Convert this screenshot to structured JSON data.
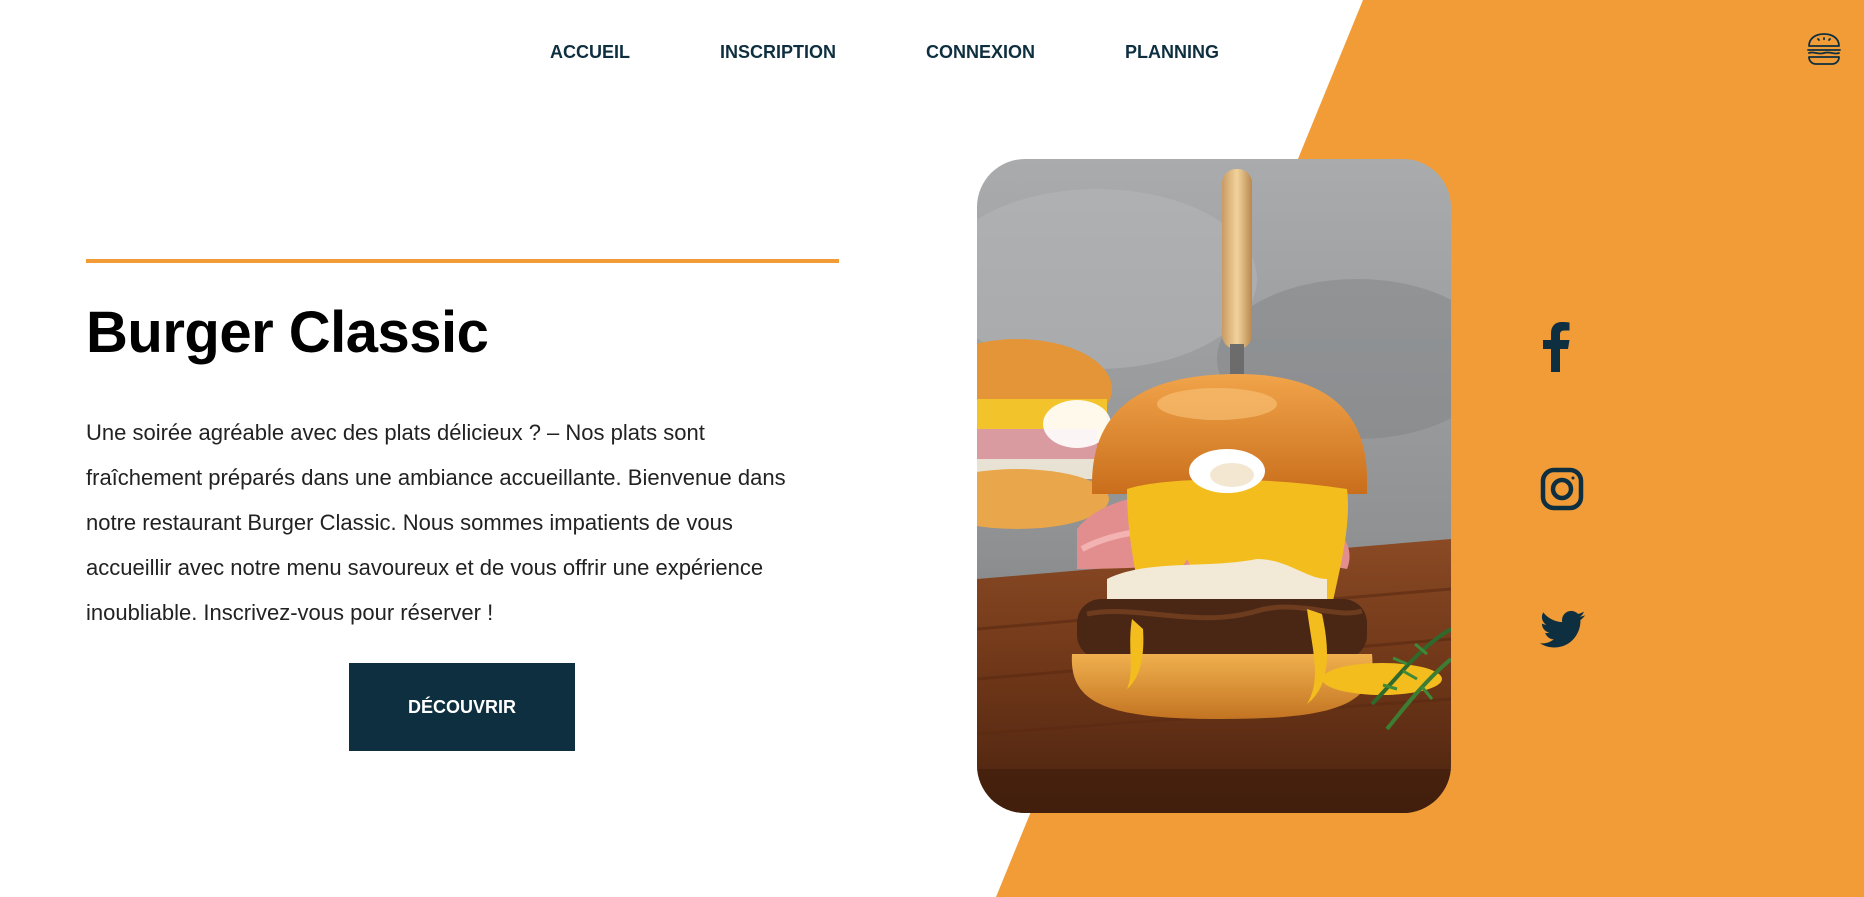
{
  "colors": {
    "accent": "#f29c38",
    "dark": "#0e2f3f",
    "background": "#ffffff"
  },
  "nav": {
    "items": [
      {
        "label": "ACCUEIL"
      },
      {
        "label": "INSCRIPTION"
      },
      {
        "label": "CONNEXION"
      },
      {
        "label": "PLANNING"
      }
    ]
  },
  "logo": {
    "icon": "burger-icon"
  },
  "hero": {
    "title": "Burger Classic",
    "text": "Une soirée agréable avec des plats délicieux ? – Nos plats sont fraîchement préparés dans une ambiance accueillante. Bienvenue dans notre restaurant Burger Classic. Nous sommes impatients de vous accueillir avec notre menu savoureux et de vous offrir une expérience inoubliable. Inscrivez-vous pour réserver !",
    "cta_label": "DÉCOUVRIR"
  },
  "image": {
    "icon": "burger-photo"
  },
  "social": [
    {
      "icon": "facebook-icon"
    },
    {
      "icon": "instagram-icon"
    },
    {
      "icon": "twitter-icon"
    }
  ]
}
